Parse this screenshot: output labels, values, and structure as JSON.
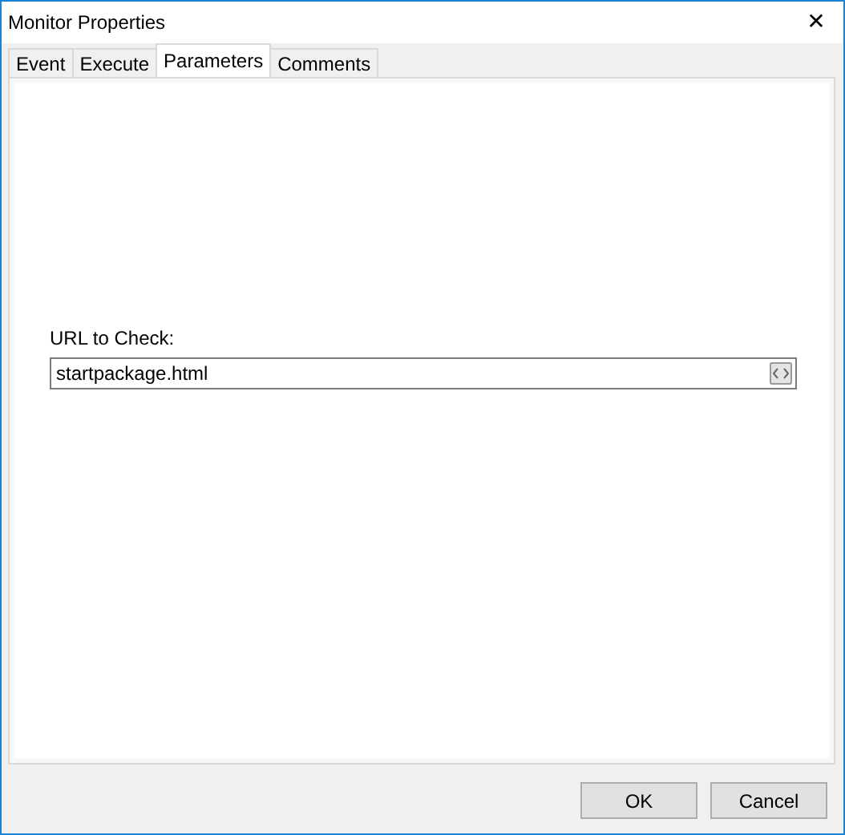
{
  "window": {
    "title": "Monitor Properties",
    "close": "✕"
  },
  "tabs": [
    {
      "label": "Event",
      "selected": false
    },
    {
      "label": "Execute",
      "selected": false
    },
    {
      "label": "Parameters",
      "selected": true
    },
    {
      "label": "Comments",
      "selected": false
    }
  ],
  "field": {
    "label": "URL to Check:",
    "value": "startpackage.html"
  },
  "buttons": [
    "OK",
    "Cancel"
  ]
}
